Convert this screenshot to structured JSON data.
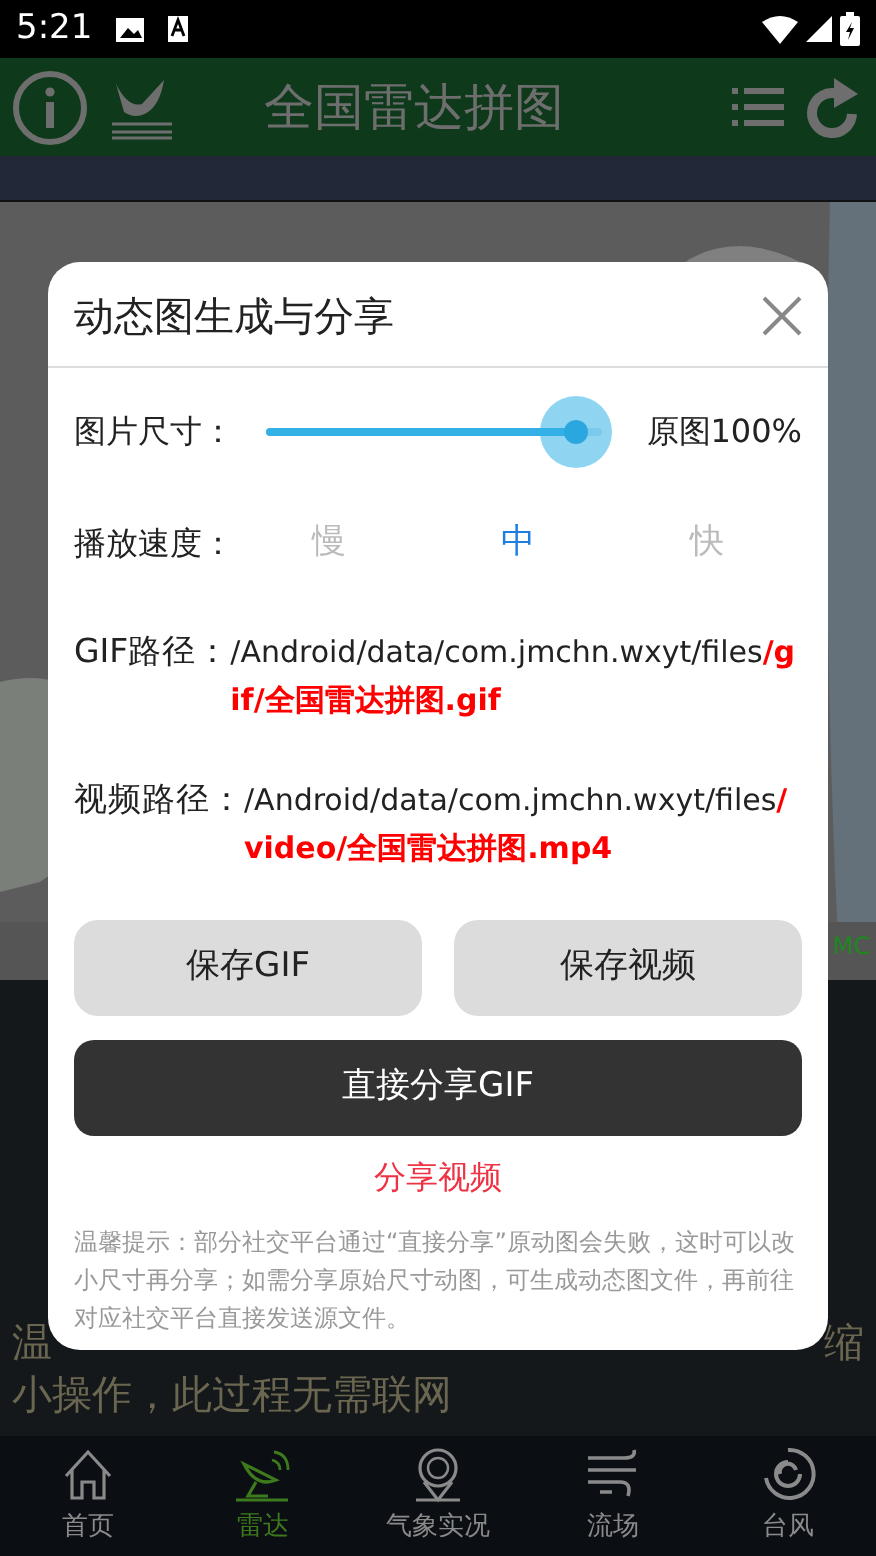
{
  "status_bar": {
    "time": "5:21"
  },
  "header": {
    "title": "全国雷达拼图"
  },
  "map": {
    "kind": "picture",
    "credit": "MC"
  },
  "notice": {
    "fragments": [
      "温",
      "缩"
    ],
    "text": "小操作，此过程无需联网"
  },
  "bottom_nav": [
    {
      "label": "首页",
      "selected": false
    },
    {
      "label": "雷达",
      "selected": true
    },
    {
      "label": "气象实况",
      "selected": false
    },
    {
      "label": "流场",
      "selected": false
    },
    {
      "label": "台风",
      "selected": false
    }
  ],
  "dialog": {
    "title": "动态图生成与分享",
    "size": {
      "label": "图片尺寸：",
      "level": 0.92,
      "reading": "原图100%"
    },
    "speed": {
      "label": "播放速度：",
      "options": [
        {
          "label": "慢",
          "selected": false
        },
        {
          "label": "中",
          "selected": true
        },
        {
          "label": "快",
          "selected": false
        }
      ]
    },
    "paths": [
      {
        "label": "GIF路径：",
        "value": "/Android/data/com.jmchn.wxyt/files**/gif/全国雷达拼图.gif**"
      },
      {
        "label": "视频路径：",
        "value": "/Android/data/com.jmchn.wxyt/files**/video/全国雷达拼图.mp4**"
      }
    ],
    "buttons": [
      {
        "label": "保存GIF",
        "kind": "secondary"
      },
      {
        "label": "保存视频",
        "kind": "secondary"
      },
      {
        "label": "直接分享GIF",
        "kind": "primary"
      },
      {
        "label": "分享视频",
        "kind": "link"
      }
    ],
    "tip": "温馨提示：部分社交平台通过“直接分享”原动图会失败，这时可以改小尺寸再分享；如需分享原始尺寸动图，可生成动态图文件，再前往对应社交平台直接发送源文件。"
  }
}
